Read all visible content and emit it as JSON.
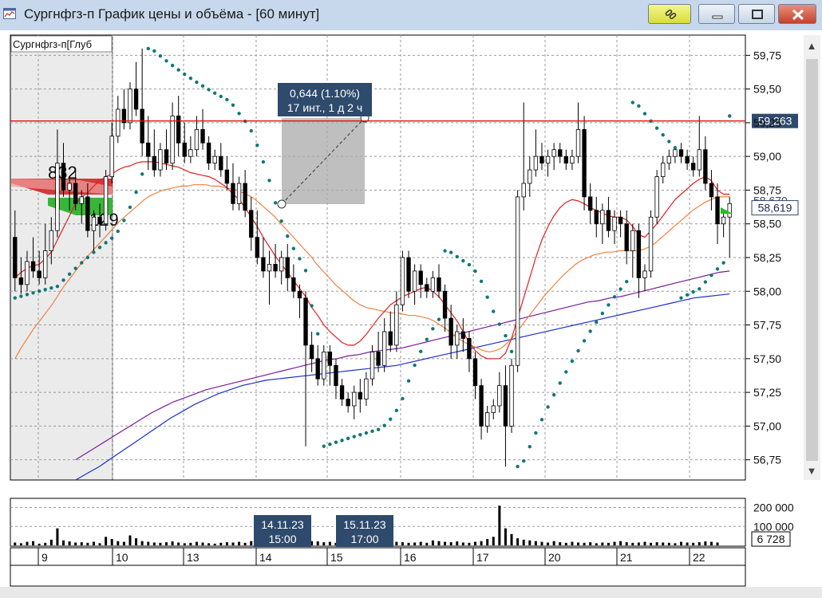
{
  "window": {
    "title": "Сургнфгз-п График цены и объёма - [60 минут]"
  },
  "panel": {
    "label": "Сургнфгз-п[Глуб"
  },
  "chart_data": {
    "type": "candlestick",
    "price_axis": {
      "ylim": [
        56.6,
        59.9
      ],
      "ticks": [
        "59,75",
        "59,50",
        "59,25",
        "59,00",
        "58,75",
        "58,50",
        "58,25",
        "58,00",
        "57,75",
        "57,50",
        "57,25",
        "57,00",
        "56,75"
      ],
      "tick_values": [
        59.75,
        59.5,
        59.25,
        59.0,
        58.75,
        58.5,
        58.25,
        58.0,
        57.75,
        57.5,
        57.25,
        57.0,
        56.75
      ]
    },
    "price_labels": {
      "level_line": "59,263",
      "level_value": 59.263,
      "last_price": "58,619",
      "last_value": 58.619,
      "behind_label": "58,670"
    },
    "depth": {
      "bid_volume": "832",
      "ask_volume": "129"
    },
    "measure": {
      "line1": "0,644 (1.10%)",
      "line2": "17 инт., 1 д 2 ч"
    },
    "date_axis": {
      "labels": [
        "9",
        "10",
        "13",
        "14",
        "15",
        "16",
        "17",
        "20",
        "21",
        "22"
      ]
    },
    "hover_dates": [
      {
        "date": "14.11.23",
        "time": "15:00"
      },
      {
        "date": "15.11.23",
        "time": "17:00"
      }
    ],
    "volume_axis": {
      "ylim": [
        0,
        240000
      ],
      "ticks": [
        "200 000",
        "100 000"
      ],
      "tick_values": [
        200000,
        100000
      ],
      "current": "6 728"
    },
    "ohlc": [
      {
        "o": 58.4,
        "h": 58.6,
        "l": 58.0,
        "c": 58.1
      },
      {
        "o": 58.1,
        "h": 58.25,
        "l": 57.98,
        "c": 58.05
      },
      {
        "o": 58.05,
        "h": 58.3,
        "l": 58.0,
        "c": 58.22
      },
      {
        "o": 58.22,
        "h": 58.4,
        "l": 58.1,
        "c": 58.15
      },
      {
        "o": 58.15,
        "h": 58.3,
        "l": 58.05,
        "c": 58.1
      },
      {
        "o": 58.1,
        "h": 58.5,
        "l": 58.05,
        "c": 58.3
      },
      {
        "o": 58.3,
        "h": 58.55,
        "l": 58.2,
        "c": 58.45
      },
      {
        "o": 58.45,
        "h": 59.2,
        "l": 58.4,
        "c": 58.95
      },
      {
        "o": 58.95,
        "h": 59.1,
        "l": 58.7,
        "c": 58.75
      },
      {
        "o": 58.75,
        "h": 58.85,
        "l": 58.6,
        "c": 58.8
      },
      {
        "o": 58.8,
        "h": 58.9,
        "l": 58.6,
        "c": 58.65
      },
      {
        "o": 58.65,
        "h": 58.75,
        "l": 58.5,
        "c": 58.7
      },
      {
        "o": 58.7,
        "h": 58.8,
        "l": 58.4,
        "c": 58.45
      },
      {
        "o": 58.45,
        "h": 58.6,
        "l": 58.3,
        "c": 58.55
      },
      {
        "o": 58.55,
        "h": 58.65,
        "l": 58.4,
        "c": 58.5
      },
      {
        "o": 58.5,
        "h": 58.9,
        "l": 58.45,
        "c": 58.85
      },
      {
        "o": 58.85,
        "h": 59.25,
        "l": 58.8,
        "c": 59.15
      },
      {
        "o": 59.15,
        "h": 59.45,
        "l": 59.1,
        "c": 59.35
      },
      {
        "o": 59.35,
        "h": 59.5,
        "l": 59.2,
        "c": 59.25
      },
      {
        "o": 59.25,
        "h": 59.55,
        "l": 59.2,
        "c": 59.5
      },
      {
        "o": 59.5,
        "h": 59.7,
        "l": 59.3,
        "c": 59.35
      },
      {
        "o": 59.35,
        "h": 59.8,
        "l": 59.0,
        "c": 59.1
      },
      {
        "o": 59.1,
        "h": 59.3,
        "l": 58.9,
        "c": 59.0
      },
      {
        "o": 59.0,
        "h": 59.2,
        "l": 58.85,
        "c": 58.9
      },
      {
        "o": 58.9,
        "h": 59.1,
        "l": 58.85,
        "c": 59.05
      },
      {
        "o": 59.05,
        "h": 59.2,
        "l": 58.9,
        "c": 58.95
      },
      {
        "o": 58.95,
        "h": 59.4,
        "l": 58.9,
        "c": 59.3
      },
      {
        "o": 59.3,
        "h": 59.45,
        "l": 59.0,
        "c": 59.1
      },
      {
        "o": 59.1,
        "h": 59.25,
        "l": 58.95,
        "c": 59.0
      },
      {
        "o": 59.0,
        "h": 59.15,
        "l": 58.95,
        "c": 59.05
      },
      {
        "o": 59.05,
        "h": 59.3,
        "l": 59.0,
        "c": 59.2
      },
      {
        "o": 59.2,
        "h": 59.35,
        "l": 59.05,
        "c": 59.1
      },
      {
        "o": 59.1,
        "h": 59.15,
        "l": 58.9,
        "c": 58.95
      },
      {
        "o": 58.95,
        "h": 59.05,
        "l": 58.9,
        "c": 59.0
      },
      {
        "o": 59.0,
        "h": 59.1,
        "l": 58.85,
        "c": 58.9
      },
      {
        "o": 58.9,
        "h": 59.0,
        "l": 58.75,
        "c": 58.8
      },
      {
        "o": 58.8,
        "h": 58.95,
        "l": 58.6,
        "c": 58.65
      },
      {
        "o": 58.65,
        "h": 58.85,
        "l": 58.6,
        "c": 58.8
      },
      {
        "o": 58.8,
        "h": 58.9,
        "l": 58.55,
        "c": 58.6
      },
      {
        "o": 58.6,
        "h": 58.7,
        "l": 58.3,
        "c": 58.4
      },
      {
        "o": 58.4,
        "h": 58.6,
        "l": 58.2,
        "c": 58.25
      },
      {
        "o": 58.25,
        "h": 58.4,
        "l": 58.1,
        "c": 58.15
      },
      {
        "o": 58.15,
        "h": 58.3,
        "l": 57.9,
        "c": 58.2
      },
      {
        "o": 58.2,
        "h": 58.35,
        "l": 58.1,
        "c": 58.15
      },
      {
        "o": 58.15,
        "h": 58.3,
        "l": 58.05,
        "c": 58.25
      },
      {
        "o": 58.25,
        "h": 58.35,
        "l": 58.0,
        "c": 58.1
      },
      {
        "o": 58.1,
        "h": 58.2,
        "l": 57.95,
        "c": 58.0
      },
      {
        "o": 58.0,
        "h": 58.05,
        "l": 57.8,
        "c": 57.95
      },
      {
        "o": 57.95,
        "h": 58.0,
        "l": 56.85,
        "c": 57.6
      },
      {
        "o": 57.6,
        "h": 57.7,
        "l": 57.4,
        "c": 57.5
      },
      {
        "o": 57.5,
        "h": 57.6,
        "l": 57.3,
        "c": 57.35
      },
      {
        "o": 57.35,
        "h": 57.6,
        "l": 57.3,
        "c": 57.55
      },
      {
        "o": 57.55,
        "h": 57.6,
        "l": 57.3,
        "c": 57.45
      },
      {
        "o": 57.45,
        "h": 57.5,
        "l": 57.2,
        "c": 57.3
      },
      {
        "o": 57.3,
        "h": 57.35,
        "l": 57.15,
        "c": 57.2
      },
      {
        "o": 57.2,
        "h": 57.25,
        "l": 57.1,
        "c": 57.15
      },
      {
        "o": 57.15,
        "h": 57.3,
        "l": 57.05,
        "c": 57.25
      },
      {
        "o": 57.25,
        "h": 57.35,
        "l": 57.1,
        "c": 57.2
      },
      {
        "o": 57.2,
        "h": 57.4,
        "l": 57.15,
        "c": 57.35
      },
      {
        "o": 57.35,
        "h": 57.6,
        "l": 57.3,
        "c": 57.55
      },
      {
        "o": 57.55,
        "h": 57.7,
        "l": 57.4,
        "c": 57.45
      },
      {
        "o": 57.45,
        "h": 57.8,
        "l": 57.4,
        "c": 57.7
      },
      {
        "o": 57.7,
        "h": 57.85,
        "l": 57.55,
        "c": 57.6
      },
      {
        "o": 57.6,
        "h": 58.0,
        "l": 57.55,
        "c": 57.9
      },
      {
        "o": 57.9,
        "h": 58.3,
        "l": 57.85,
        "c": 58.25
      },
      {
        "o": 58.25,
        "h": 58.3,
        "l": 57.95,
        "c": 58.0
      },
      {
        "o": 58.0,
        "h": 58.2,
        "l": 57.9,
        "c": 58.15
      },
      {
        "o": 58.15,
        "h": 58.2,
        "l": 57.95,
        "c": 58.05
      },
      {
        "o": 58.05,
        "h": 58.1,
        "l": 57.95,
        "c": 58.0
      },
      {
        "o": 58.0,
        "h": 58.15,
        "l": 57.95,
        "c": 58.1
      },
      {
        "o": 58.1,
        "h": 58.2,
        "l": 57.95,
        "c": 58.0
      },
      {
        "o": 58.0,
        "h": 58.05,
        "l": 57.7,
        "c": 57.8
      },
      {
        "o": 57.8,
        "h": 57.9,
        "l": 57.5,
        "c": 57.6
      },
      {
        "o": 57.6,
        "h": 57.75,
        "l": 57.5,
        "c": 57.7
      },
      {
        "o": 57.7,
        "h": 57.8,
        "l": 57.55,
        "c": 57.65
      },
      {
        "o": 57.65,
        "h": 57.7,
        "l": 57.4,
        "c": 57.5
      },
      {
        "o": 57.5,
        "h": 57.55,
        "l": 57.2,
        "c": 57.3
      },
      {
        "o": 57.3,
        "h": 57.35,
        "l": 56.9,
        "c": 57.0
      },
      {
        "o": 57.0,
        "h": 57.15,
        "l": 56.95,
        "c": 57.1
      },
      {
        "o": 57.1,
        "h": 57.2,
        "l": 57.05,
        "c": 57.15
      },
      {
        "o": 57.15,
        "h": 57.4,
        "l": 57.1,
        "c": 57.3
      },
      {
        "o": 57.3,
        "h": 57.45,
        "l": 56.7,
        "c": 57.0
      },
      {
        "o": 57.0,
        "h": 57.5,
        "l": 56.95,
        "c": 57.45
      },
      {
        "o": 57.45,
        "h": 58.75,
        "l": 57.4,
        "c": 58.7
      },
      {
        "o": 58.7,
        "h": 59.4,
        "l": 58.6,
        "c": 58.8
      },
      {
        "o": 58.8,
        "h": 59.0,
        "l": 58.7,
        "c": 58.9
      },
      {
        "o": 58.9,
        "h": 59.2,
        "l": 58.85,
        "c": 59.0
      },
      {
        "o": 59.0,
        "h": 59.1,
        "l": 58.9,
        "c": 58.95
      },
      {
        "o": 58.95,
        "h": 59.05,
        "l": 58.85,
        "c": 59.0
      },
      {
        "o": 59.0,
        "h": 59.1,
        "l": 58.9,
        "c": 59.05
      },
      {
        "o": 59.05,
        "h": 59.1,
        "l": 58.95,
        "c": 59.0
      },
      {
        "o": 59.0,
        "h": 59.05,
        "l": 58.9,
        "c": 58.95
      },
      {
        "o": 58.95,
        "h": 59.05,
        "l": 58.9,
        "c": 59.0
      },
      {
        "o": 59.0,
        "h": 59.4,
        "l": 58.95,
        "c": 59.2
      },
      {
        "o": 59.2,
        "h": 59.3,
        "l": 58.6,
        "c": 58.7
      },
      {
        "o": 58.7,
        "h": 58.8,
        "l": 58.5,
        "c": 58.6
      },
      {
        "o": 58.6,
        "h": 58.7,
        "l": 58.4,
        "c": 58.5
      },
      {
        "o": 58.5,
        "h": 58.65,
        "l": 58.35,
        "c": 58.6
      },
      {
        "o": 58.6,
        "h": 58.7,
        "l": 58.4,
        "c": 58.45
      },
      {
        "o": 58.45,
        "h": 58.6,
        "l": 58.35,
        "c": 58.55
      },
      {
        "o": 58.55,
        "h": 58.6,
        "l": 58.4,
        "c": 58.5
      },
      {
        "o": 58.5,
        "h": 58.6,
        "l": 58.2,
        "c": 58.3
      },
      {
        "o": 58.3,
        "h": 58.5,
        "l": 58.1,
        "c": 58.45
      },
      {
        "o": 58.45,
        "h": 58.5,
        "l": 57.95,
        "c": 58.1
      },
      {
        "o": 58.1,
        "h": 58.2,
        "l": 58.0,
        "c": 58.15
      },
      {
        "o": 58.15,
        "h": 58.6,
        "l": 58.1,
        "c": 58.55
      },
      {
        "o": 58.55,
        "h": 58.9,
        "l": 58.5,
        "c": 58.85
      },
      {
        "o": 58.85,
        "h": 59.0,
        "l": 58.8,
        "c": 58.95
      },
      {
        "o": 58.95,
        "h": 59.05,
        "l": 58.9,
        "c": 59.0
      },
      {
        "o": 59.0,
        "h": 59.05,
        "l": 58.95,
        "c": 59.05
      },
      {
        "o": 59.05,
        "h": 59.1,
        "l": 58.95,
        "c": 59.0
      },
      {
        "o": 59.0,
        "h": 59.05,
        "l": 58.9,
        "c": 58.95
      },
      {
        "o": 58.95,
        "h": 59.0,
        "l": 58.85,
        "c": 58.9
      },
      {
        "o": 58.9,
        "h": 59.3,
        "l": 58.85,
        "c": 59.05
      },
      {
        "o": 59.05,
        "h": 59.15,
        "l": 58.75,
        "c": 58.8
      },
      {
        "o": 58.8,
        "h": 58.9,
        "l": 58.6,
        "c": 58.7
      },
      {
        "o": 58.7,
        "h": 58.8,
        "l": 58.35,
        "c": 58.5
      },
      {
        "o": 58.5,
        "h": 58.6,
        "l": 58.4,
        "c": 58.55
      },
      {
        "o": 58.55,
        "h": 58.7,
        "l": 58.25,
        "c": 58.65
      }
    ],
    "volumes": [
      20,
      15,
      25,
      30,
      12,
      18,
      40,
      120,
      35,
      28,
      20,
      22,
      18,
      25,
      15,
      60,
      45,
      30,
      25,
      70,
      50,
      30,
      25,
      20,
      18,
      22,
      28,
      20,
      15,
      18,
      25,
      20,
      15,
      12,
      18,
      22,
      20,
      25,
      18,
      30,
      22,
      18,
      15,
      20,
      25,
      18,
      22,
      15,
      45,
      30,
      28,
      22,
      25,
      18,
      15,
      20,
      18,
      15,
      12,
      18,
      40,
      35,
      30,
      25,
      22,
      18,
      20,
      25,
      18,
      35,
      30,
      25,
      22,
      28,
      20,
      18,
      25,
      30,
      45,
      60,
      280,
      120,
      80,
      50,
      40,
      35,
      30,
      25,
      20,
      30,
      22,
      18,
      25,
      20,
      18,
      22,
      15,
      20,
      18,
      25,
      30,
      22,
      18,
      20,
      25,
      18,
      22,
      20,
      18,
      15,
      25,
      20,
      18,
      22,
      28,
      25,
      20
    ],
    "ma_red": [
      58.1,
      58.14,
      58.17,
      58.19,
      58.2,
      58.24,
      58.29,
      58.38,
      58.47,
      58.56,
      58.65,
      58.7,
      58.73,
      58.78,
      58.82,
      58.85,
      58.87,
      58.9,
      58.92,
      58.93,
      58.95,
      58.96,
      58.96,
      58.96,
      58.95,
      58.94,
      58.93,
      58.92,
      58.9,
      58.88,
      58.87,
      58.86,
      58.85,
      58.83,
      58.8,
      58.77,
      58.72,
      58.68,
      58.62,
      58.55,
      58.48,
      58.4,
      58.33,
      58.26,
      58.2,
      58.14,
      58.08,
      58.02,
      57.96,
      57.88,
      57.82,
      57.75,
      57.7,
      57.66,
      57.62,
      57.6,
      57.6,
      57.63,
      57.68,
      57.74,
      57.8,
      57.85,
      57.9,
      57.93,
      57.96,
      57.98,
      58.0,
      58.02,
      58.03,
      58.0,
      57.96,
      57.9,
      57.84,
      57.78,
      57.7,
      57.62,
      57.56,
      57.52,
      57.5,
      57.5,
      57.5,
      57.54,
      57.65,
      57.8,
      57.95,
      58.1,
      58.25,
      58.38,
      58.48,
      58.56,
      58.62,
      58.66,
      58.68,
      58.67,
      58.65,
      58.62,
      58.6,
      58.58,
      58.56,
      58.55,
      58.55,
      58.53,
      58.48,
      58.42,
      58.4,
      58.45,
      58.5,
      58.56,
      58.62,
      58.68,
      58.72,
      58.76,
      58.8,
      58.83,
      58.85,
      58.82,
      58.75,
      58.72,
      58.72
    ],
    "ma_orange": [
      57.5,
      57.58,
      57.65,
      57.72,
      57.78,
      57.84,
      57.9,
      57.97,
      58.04,
      58.1,
      58.16,
      58.22,
      58.27,
      58.32,
      58.37,
      58.42,
      58.47,
      58.52,
      58.56,
      58.6,
      58.64,
      58.68,
      58.71,
      58.73,
      58.75,
      58.76,
      58.77,
      58.78,
      58.78,
      58.79,
      58.79,
      58.79,
      58.78,
      58.78,
      58.77,
      58.76,
      58.75,
      58.73,
      58.71,
      58.68,
      58.64,
      58.6,
      58.56,
      58.51,
      58.46,
      58.41,
      58.36,
      58.31,
      58.26,
      58.2,
      58.15,
      58.1,
      58.05,
      58.01,
      57.97,
      57.93,
      57.9,
      57.88,
      57.87,
      57.86,
      57.85,
      57.84,
      57.84,
      57.83,
      57.82,
      57.82,
      57.81,
      57.8,
      57.78,
      57.75,
      57.72,
      57.68,
      57.65,
      57.62,
      57.6,
      57.58,
      57.56,
      57.55,
      57.56,
      57.58,
      57.62,
      57.67,
      57.73,
      57.79,
      57.85,
      57.91,
      57.97,
      58.02,
      58.07,
      58.12,
      58.16,
      58.2,
      58.23,
      58.25,
      58.27,
      58.28,
      58.29,
      58.29,
      58.3,
      58.3,
      58.3,
      58.3,
      58.31,
      58.33,
      58.36,
      58.4,
      58.44,
      58.48,
      58.52,
      58.56,
      58.6,
      58.63,
      58.66,
      58.68,
      58.7,
      58.7,
      58.7
    ],
    "ma_purple": [
      56.75,
      56.8,
      56.85,
      56.9,
      56.95,
      57.0,
      57.05,
      57.1,
      57.14,
      57.18,
      57.21,
      57.24,
      57.27,
      57.29,
      57.31,
      57.33,
      57.35,
      57.37,
      57.39,
      57.41,
      57.43,
      57.45,
      57.47,
      57.49,
      57.5,
      57.52,
      57.53,
      57.55,
      57.56,
      57.57,
      57.58,
      57.6,
      57.62,
      57.64,
      57.66,
      57.68,
      57.7,
      57.72,
      57.74,
      57.76,
      57.78,
      57.8,
      57.82,
      57.84,
      57.86,
      57.88,
      57.9,
      57.92,
      57.93,
      57.95,
      57.96,
      57.98,
      58.0,
      58.02,
      58.04,
      58.06,
      58.08,
      58.1,
      58.12,
      58.14,
      58.15
    ],
    "ma_blue": [
      56.6,
      56.65,
      56.7,
      56.76,
      56.82,
      56.88,
      56.94,
      57.0,
      57.06,
      57.11,
      57.16,
      57.2,
      57.24,
      57.27,
      57.3,
      57.32,
      57.34,
      57.35,
      57.36,
      57.37,
      57.38,
      57.39,
      57.4,
      57.41,
      57.42,
      57.43,
      57.44,
      57.45,
      57.47,
      57.49,
      57.51,
      57.53,
      57.55,
      57.57,
      57.59,
      57.61,
      57.63,
      57.65,
      57.67,
      57.69,
      57.71,
      57.73,
      57.75,
      57.77,
      57.79,
      57.81,
      57.83,
      57.85,
      57.87,
      57.89,
      57.91,
      57.93,
      57.95,
      57.96,
      57.97,
      57.98
    ]
  }
}
